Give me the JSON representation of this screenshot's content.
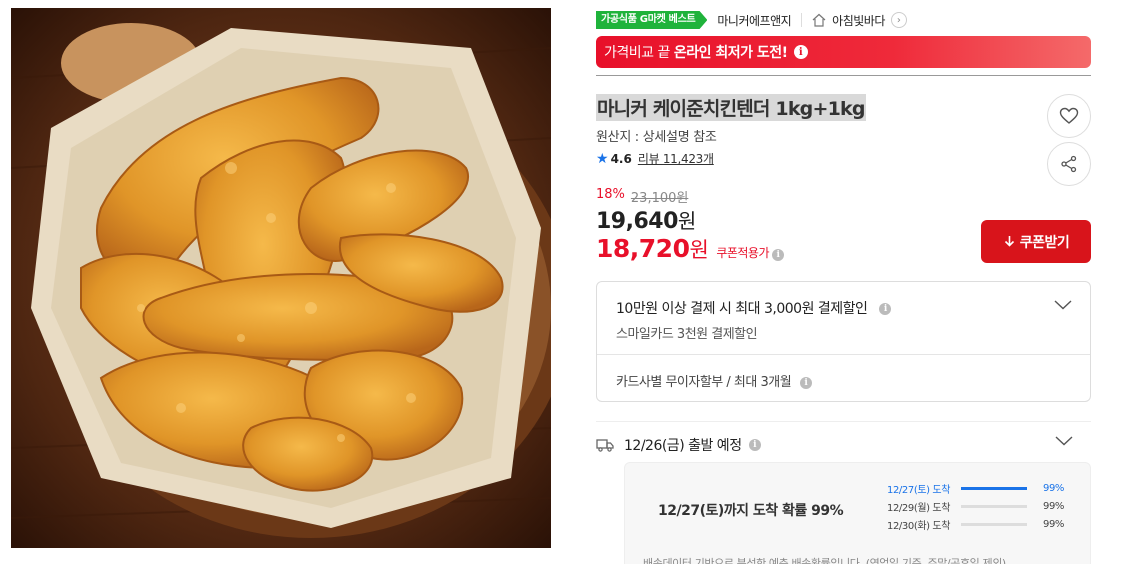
{
  "badges": {
    "best": "가공식품 G마켓 베스트",
    "seller": "마니커에프앤지",
    "store": "아침빛바다",
    "store_chevron": "›"
  },
  "promo": {
    "prefix": "가격비교 끝",
    "strong": "온라인 최저가 도전!",
    "info": "i"
  },
  "product": {
    "title": "마니커 케이준치킨텐더 1kg+1kg",
    "origin": "원산지 : 상세설명 참조",
    "rating": "4.6",
    "reviews": "리뷰 11,423개"
  },
  "pricing": {
    "discount": "18%",
    "original": "23,100원",
    "price_number": "19,640",
    "price_unit": "원",
    "coupon_number": "18,720",
    "coupon_unit": "원",
    "coupon_label": "쿠폰적용가",
    "coupon_button": "쿠폰받기"
  },
  "benefits": {
    "title": "10만원 이상 결제 시 최대 3,000원 결제할인",
    "sub": "스마일카드 3천원 결제할인",
    "installment": "카드사별 무이자할부 / 최대 3개월"
  },
  "shipping": {
    "departure": "12/26(금) 출발 예정",
    "main": "12/27(토)까지 도착 확률 99%",
    "rows": [
      {
        "date": "12/27(토) 도착",
        "pct": "99%",
        "level": 1.0
      },
      {
        "date": "12/29(월) 도착",
        "pct": "99%",
        "level": 0.0
      },
      {
        "date": "12/30(화) 도착",
        "pct": "99%",
        "level": 0.0
      }
    ],
    "note": "배송데이터 기반으로 분석한 예측 배송확률입니다. (영업일 기준, 주말/공휴일 제외)"
  },
  "colors": {
    "accent_red": "#e8102a",
    "best_green": "#1fb33b",
    "blue": "#1a73e8"
  },
  "icons": [
    "home-icon",
    "heart-icon",
    "share-icon",
    "star-icon",
    "download-icon",
    "chevron-down-icon",
    "truck-icon",
    "info-icon"
  ]
}
